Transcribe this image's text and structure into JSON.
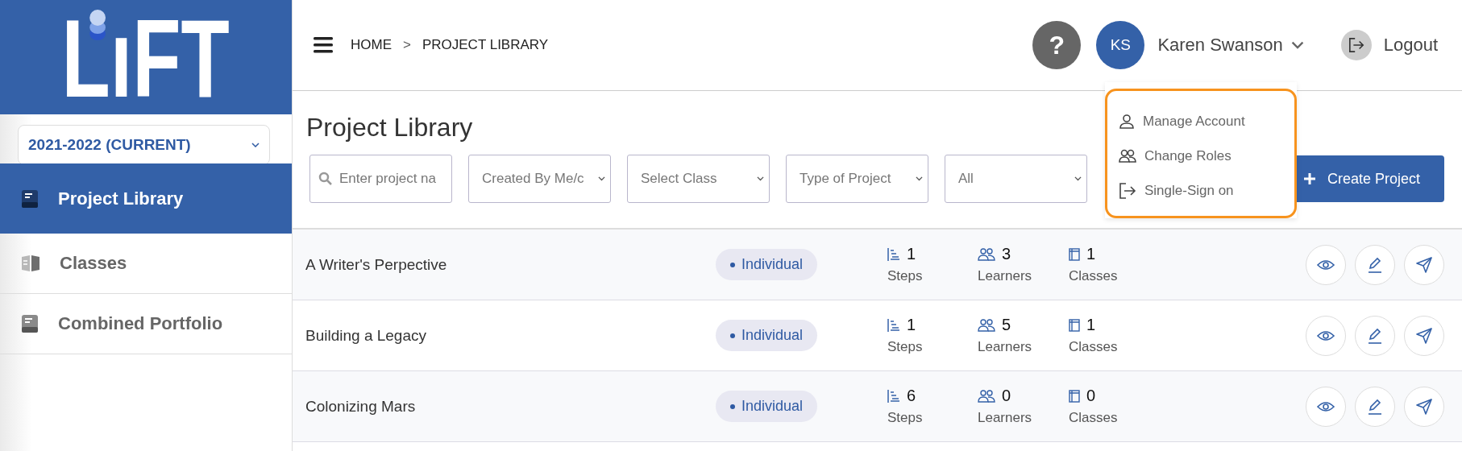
{
  "sidebar": {
    "logo": "LıFT",
    "year_select": {
      "value": "2021-2022 (CURRENT)"
    },
    "items": [
      {
        "label": "Project Library",
        "selected": true,
        "kind": "book"
      },
      {
        "label": "Classes",
        "selected": false,
        "kind": "open-book"
      },
      {
        "label": "Combined Portfolio",
        "selected": false,
        "kind": "book"
      }
    ]
  },
  "header": {
    "breadcrumb": [
      "HOME",
      ">",
      "PROJECT LIBRARY"
    ],
    "help": "?",
    "avatar": "KS",
    "user_name": "Karen Swanson",
    "logout": "Logout"
  },
  "user_menu": {
    "expanded": true,
    "items": [
      {
        "label": "Manage Account",
        "kind": "person"
      },
      {
        "label": "Change Roles",
        "kind": "people"
      },
      {
        "label": "Single-Sign on",
        "kind": "signout"
      }
    ]
  },
  "page_title": "Project Library",
  "filters": [
    {
      "kind": "search",
      "placeholder": "Enter project na"
    },
    {
      "kind": "select",
      "value": "Created By Me/c"
    },
    {
      "kind": "select",
      "value": "Select Class"
    },
    {
      "kind": "select",
      "value": "Type of Project"
    },
    {
      "kind": "select",
      "value": "All"
    }
  ],
  "create_button": "Create Project",
  "projects": [
    {
      "name": "A Writer's Perpective",
      "type": "Individual",
      "steps": "1",
      "steps_label": "Steps",
      "learners": "3",
      "learners_label": "Learners",
      "classes": "1",
      "classes_label": "Classes"
    },
    {
      "name": "Building a Legacy",
      "type": "Individual",
      "steps": "1",
      "steps_label": "Steps",
      "learners": "5",
      "learners_label": "Learners",
      "classes": "1",
      "classes_label": "Classes"
    },
    {
      "name": "Colonizing Mars",
      "type": "Individual",
      "steps": "6",
      "steps_label": "Steps",
      "learners": "0",
      "learners_label": "Learners",
      "classes": "0",
      "classes_label": "Classes"
    }
  ]
}
